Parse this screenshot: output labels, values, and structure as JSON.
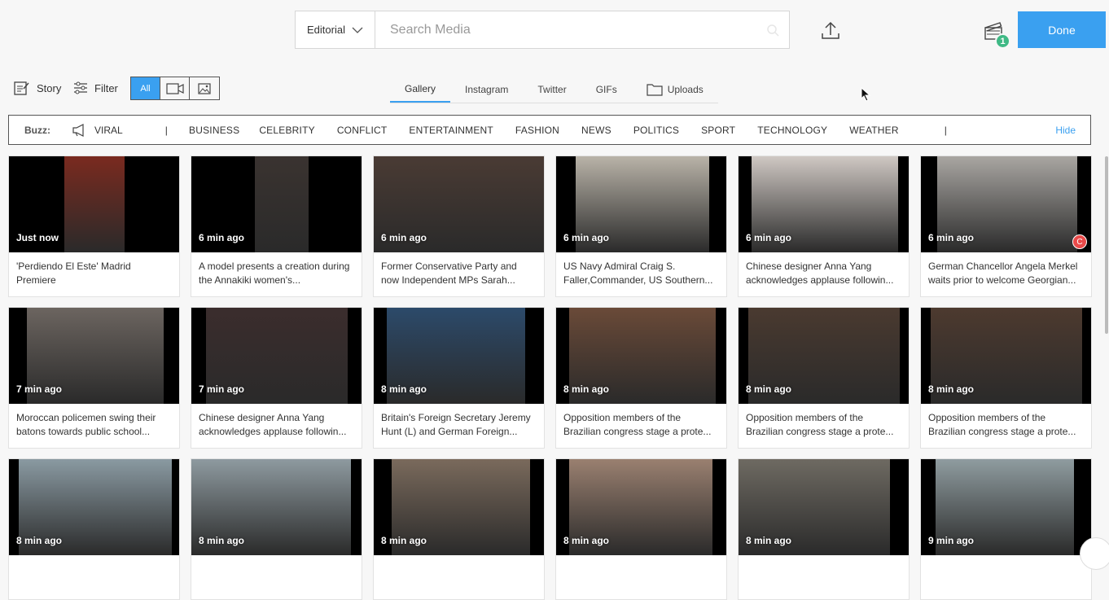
{
  "search": {
    "type_label": "Editorial",
    "placeholder": "Search Media"
  },
  "header": {
    "done_label": "Done",
    "badge_count": "1"
  },
  "toolbar": {
    "story_label": "Story",
    "filter_label": "Filter",
    "all_label": "All"
  },
  "tabs": [
    {
      "label": "Gallery",
      "active": true
    },
    {
      "label": "Instagram"
    },
    {
      "label": "Twitter"
    },
    {
      "label": "GIFs"
    },
    {
      "label": "Uploads"
    }
  ],
  "buzz": {
    "label": "Buzz:",
    "viral": "VIRAL",
    "sep": "|",
    "categories": [
      "BUSINESS",
      "CELEBRITY",
      "CONFLICT",
      "ENTERTAINMENT",
      "FASHION",
      "NEWS",
      "POLITICS",
      "SPORT",
      "TECHNOLOGY",
      "WEATHER"
    ],
    "hide_label": "Hide"
  },
  "cards": [
    {
      "ago": "Just now",
      "caption": "'Perdiendo El Este' Madrid Premiere",
      "tone": "#7a2a1f"
    },
    {
      "ago": "6 min ago",
      "caption": "A model presents a creation during the Annakiki women's...",
      "tone": "#3a3330"
    },
    {
      "ago": "6 min ago",
      "caption": "Former Conservative Party and now Independent MPs Sarah...",
      "tone": "#4a3b34"
    },
    {
      "ago": "6 min ago",
      "caption": "US Navy Admiral Craig S. Faller,Commander, US Southern...",
      "tone": "#b9b3a8"
    },
    {
      "ago": "6 min ago",
      "caption": "Chinese designer Anna Yang acknowledges applause followin...",
      "tone": "#cfc8c3"
    },
    {
      "ago": "6 min ago",
      "caption": "German Chancellor Angela Merkel waits prior to welcome Georgian...",
      "tone": "#a9a6a2"
    },
    {
      "ago": "7 min ago",
      "caption": "Moroccan policemen swing their batons towards public school...",
      "tone": "#6c6560"
    },
    {
      "ago": "7 min ago",
      "caption": "Chinese designer Anna Yang acknowledges applause followin...",
      "tone": "#3b2d2d"
    },
    {
      "ago": "8 min ago",
      "caption": "Britain's Foreign Secretary Jeremy Hunt (L) and German Foreign...",
      "tone": "#2c4a6a"
    },
    {
      "ago": "8 min ago",
      "caption": "Opposition members of the Brazilian congress stage a prote...",
      "tone": "#6a4a38"
    },
    {
      "ago": "8 min ago",
      "caption": "Opposition members of the Brazilian congress stage a prote...",
      "tone": "#4a3a30"
    },
    {
      "ago": "8 min ago",
      "caption": "Opposition members of the Brazilian congress stage a prote...",
      "tone": "#4d3a2f"
    },
    {
      "ago": "8 min ago",
      "caption": "",
      "tone": "#8a9aa2"
    },
    {
      "ago": "8 min ago",
      "caption": "",
      "tone": "#8e9aa0"
    },
    {
      "ago": "8 min ago",
      "caption": "",
      "tone": "#7a6a5c"
    },
    {
      "ago": "8 min ago",
      "caption": "",
      "tone": "#9a8070"
    },
    {
      "ago": "8 min ago",
      "caption": "",
      "tone": "#6e6a62"
    },
    {
      "ago": "9 min ago",
      "caption": "",
      "tone": "#8f9ca0"
    }
  ],
  "colors": {
    "accent": "#3aa0f0",
    "badge": "#3fb985"
  }
}
